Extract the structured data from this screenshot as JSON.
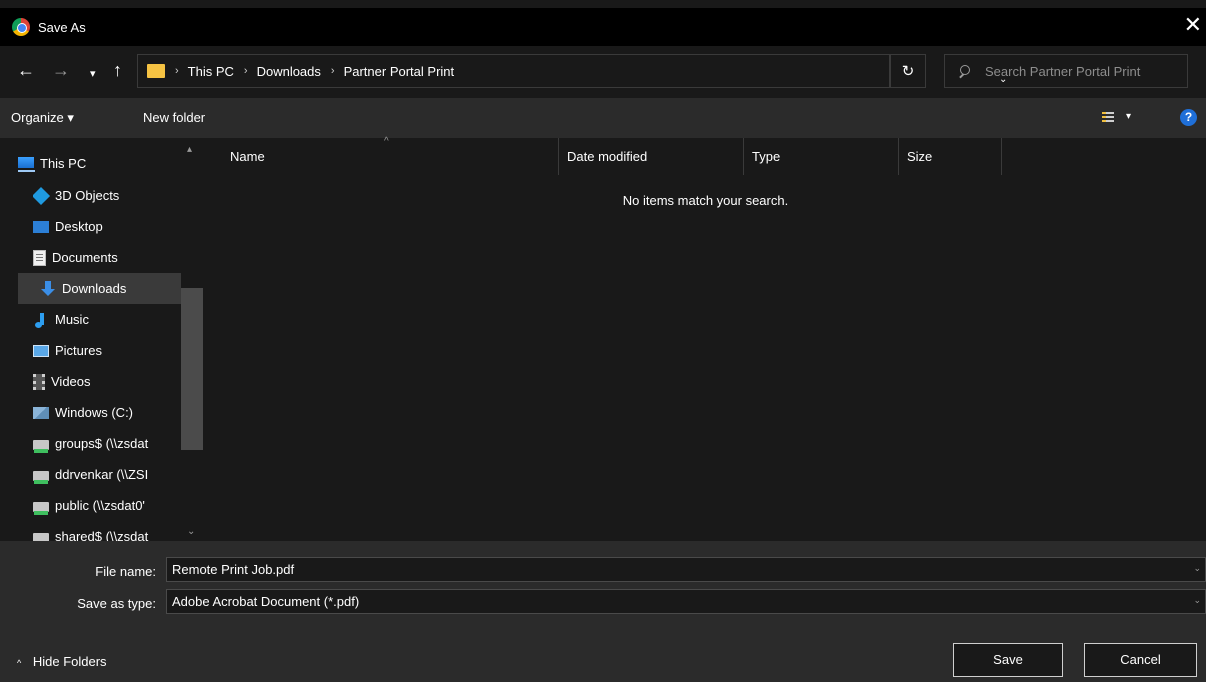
{
  "window": {
    "title": "Save As",
    "close_glyph": "✕"
  },
  "nav_buttons": {
    "back": "←",
    "forward": "→",
    "recent": "▾",
    "up": "↑"
  },
  "address": {
    "crumbs": [
      "This PC",
      "Downloads",
      "Partner Portal Print"
    ],
    "separator": "›",
    "dropdown_glyph": "⌄",
    "refresh_glyph": "↻"
  },
  "search": {
    "placeholder": "Search Partner Portal Print"
  },
  "toolbar": {
    "organize_label": "Organize ▾",
    "new_folder_label": "New folder",
    "view_drop": "▾",
    "help_label": "?"
  },
  "nav_pane": {
    "items": [
      {
        "label": "This PC",
        "icon": "computer-icon"
      },
      {
        "label": "3D Objects",
        "icon": "3d-objects-icon"
      },
      {
        "label": "Desktop",
        "icon": "desktop-icon"
      },
      {
        "label": "Documents",
        "icon": "documents-icon"
      },
      {
        "label": "Downloads",
        "icon": "download-arrow-icon",
        "selected": true
      },
      {
        "label": "Music",
        "icon": "music-note-icon"
      },
      {
        "label": "Pictures",
        "icon": "pictures-icon"
      },
      {
        "label": "Videos",
        "icon": "videos-icon"
      },
      {
        "label": "Windows (C:)",
        "icon": "drive-icon"
      },
      {
        "label": "groups$ (\\\\zsdat",
        "icon": "network-drive-icon"
      },
      {
        "label": "ddrvenkar (\\\\ZSI",
        "icon": "network-drive-icon"
      },
      {
        "label": "public (\\\\zsdat0'",
        "icon": "network-drive-icon"
      },
      {
        "label": "shared$ (\\\\zsdat",
        "icon": "network-drive-icon"
      }
    ],
    "scroll_up": "▴",
    "scroll_down": "⌄"
  },
  "columns": {
    "name": "Name",
    "date_modified": "Date modified",
    "type": "Type",
    "size": "Size",
    "sort_arrow": "^"
  },
  "content": {
    "empty_message": "No items match your search."
  },
  "form": {
    "file_name_label": "File name:",
    "file_name_value": "Remote Print Job.pdf",
    "save_type_label": "Save as type:",
    "save_type_value": "Adobe Acrobat Document (*.pdf)",
    "drop_glyph": "⌄"
  },
  "footer": {
    "hide_folders_chev": "^",
    "hide_folders_label": "Hide Folders",
    "save_label": "Save",
    "cancel_label": "Cancel"
  }
}
